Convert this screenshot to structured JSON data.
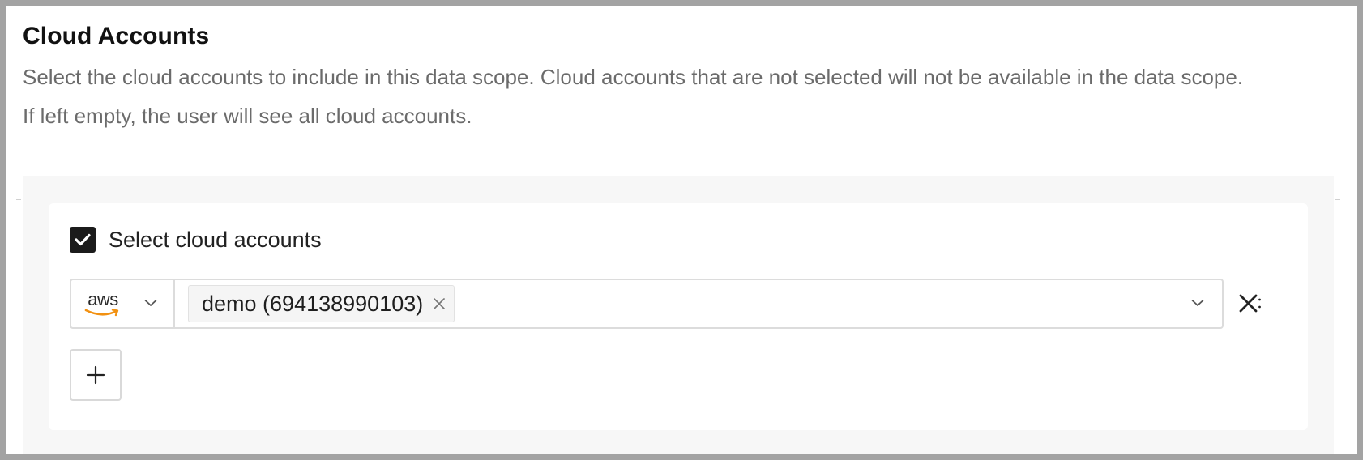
{
  "section": {
    "title": "Cloud Accounts",
    "description_line1": "Select the cloud accounts to include in this data scope. Cloud accounts that are not selected will not be available in the data scope.",
    "description_line2": "If left empty, the user will see all cloud accounts."
  },
  "selection": {
    "checkbox_label": "Select cloud accounts",
    "checked": true,
    "rows": [
      {
        "provider": "aws",
        "provider_icon": "aws-logo-icon",
        "tags": [
          {
            "label": "demo (694138990103)"
          }
        ]
      }
    ]
  },
  "icons": {
    "checkbox": "checkmark-icon",
    "provider_dropdown": "chevron-down-icon",
    "tag_remove": "close-icon",
    "select_dropdown": "chevron-down-icon",
    "row_remove": "close-icon",
    "add": "plus-icon"
  },
  "colors": {
    "aws_smile": "#f29111",
    "checkbox_fill": "#1b1b1b",
    "panel_bg": "#f7f7f7",
    "frame_bg": "#a3a3a3"
  }
}
